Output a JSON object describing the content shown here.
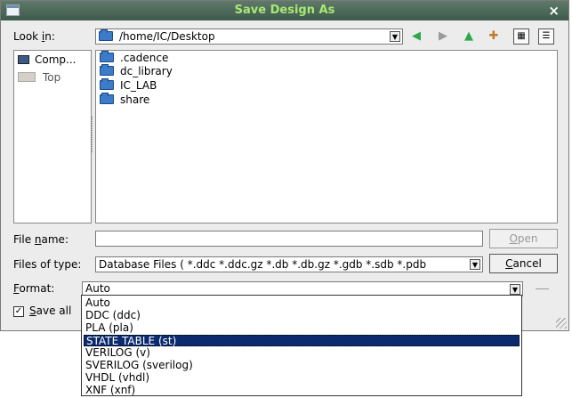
{
  "window": {
    "title": "Save Design As",
    "close_glyph": "×"
  },
  "lookin": {
    "label_pre": "Look ",
    "label_u": "i",
    "label_post": "n:",
    "path": "/home/IC/Desktop"
  },
  "toolbar": {
    "icons": [
      "back-icon",
      "forward-icon",
      "up-icon",
      "new-folder-icon",
      "list-view-icon",
      "detail-view-icon"
    ]
  },
  "sidebar": {
    "items": [
      {
        "label": "Comp...",
        "icon": "computer-icon"
      },
      {
        "label": "Top",
        "icon": "drive-icon"
      }
    ]
  },
  "files": [
    ".cadence",
    "dc_library",
    "IC_LAB",
    "share"
  ],
  "filename": {
    "label_pre": "File ",
    "label_u": "n",
    "label_post": "ame:",
    "value": ""
  },
  "filetype": {
    "label": "Files of type:",
    "value": "Database Files ( *.ddc *.ddc.gz *.db *.db.gz *.gdb *.sdb *.pdb"
  },
  "format": {
    "label_u": "F",
    "label_post": "ormat:",
    "value": "Auto",
    "options": [
      "Auto",
      "DDC (ddc)",
      "PLA (pla)",
      "STATE TABLE (st)",
      "VERILOG (v)",
      "SVERILOG (sverilog)",
      "VHDL (vhdl)",
      "XNF (xnf)"
    ],
    "highlighted_option": "STATE TABLE (st)"
  },
  "buttons": {
    "open_u": "O",
    "open_post": "pen",
    "cancel_u": "C",
    "cancel_post": "ancel"
  },
  "save_all": {
    "checked": true,
    "check_glyph": "✓",
    "label_u": "S",
    "label_post": "ave all"
  },
  "colors": {
    "titlebar": "#4b6a58",
    "title_text": "#a8e873",
    "selection": "#0c2a6e",
    "folder": "#3b7bc8"
  }
}
